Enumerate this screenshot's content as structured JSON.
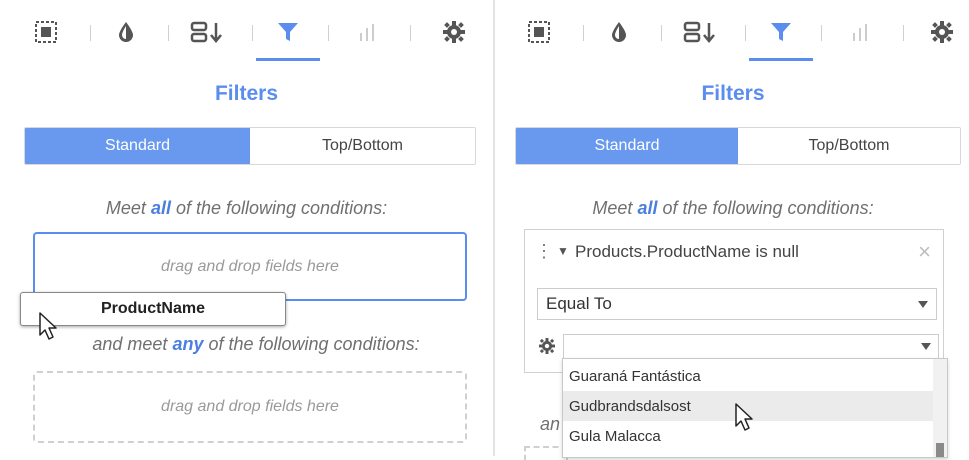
{
  "panels": {
    "left": {
      "toolbar": {
        "icons": [
          "select-region-icon",
          "droplet-icon",
          "sort-icon",
          "filter-icon",
          "bar-chart-icon",
          "gear-icon"
        ],
        "active": "filter-icon"
      },
      "title": "Filters",
      "segment": {
        "standard": "Standard",
        "top_bottom": "Top/Bottom"
      },
      "all_condition": {
        "prefix": "Meet ",
        "keyword": "all",
        "suffix": " of the following conditions:"
      },
      "all_drop_placeholder": "drag and drop fields here",
      "drag_chip": "ProductName",
      "any_condition": {
        "prefix": "and meet ",
        "keyword": "any",
        "suffix": " of the following conditions:"
      },
      "any_drop_placeholder": "drag and drop fields here"
    },
    "right": {
      "toolbar": {
        "icons": [
          "select-region-icon",
          "droplet-icon",
          "sort-icon",
          "filter-icon",
          "bar-chart-icon",
          "gear-icon"
        ],
        "active": "filter-icon"
      },
      "title": "Filters",
      "segment": {
        "standard": "Standard",
        "top_bottom": "Top/Bottom"
      },
      "all_condition": {
        "prefix": "Meet ",
        "keyword": "all",
        "suffix": " of the following conditions:"
      },
      "filter_card": {
        "header": "Products.ProductName is null",
        "operator": "Equal To",
        "value": ""
      },
      "dropdown_items": [
        "Guaraná Fantástica",
        "Gudbrandsdalsost",
        "Gula Malacca"
      ],
      "hovered_item": "Gudbrandsdalsost",
      "partial_text": "an"
    }
  },
  "colors": {
    "accent": "#5b8def",
    "segment_active": "#6899ee"
  }
}
